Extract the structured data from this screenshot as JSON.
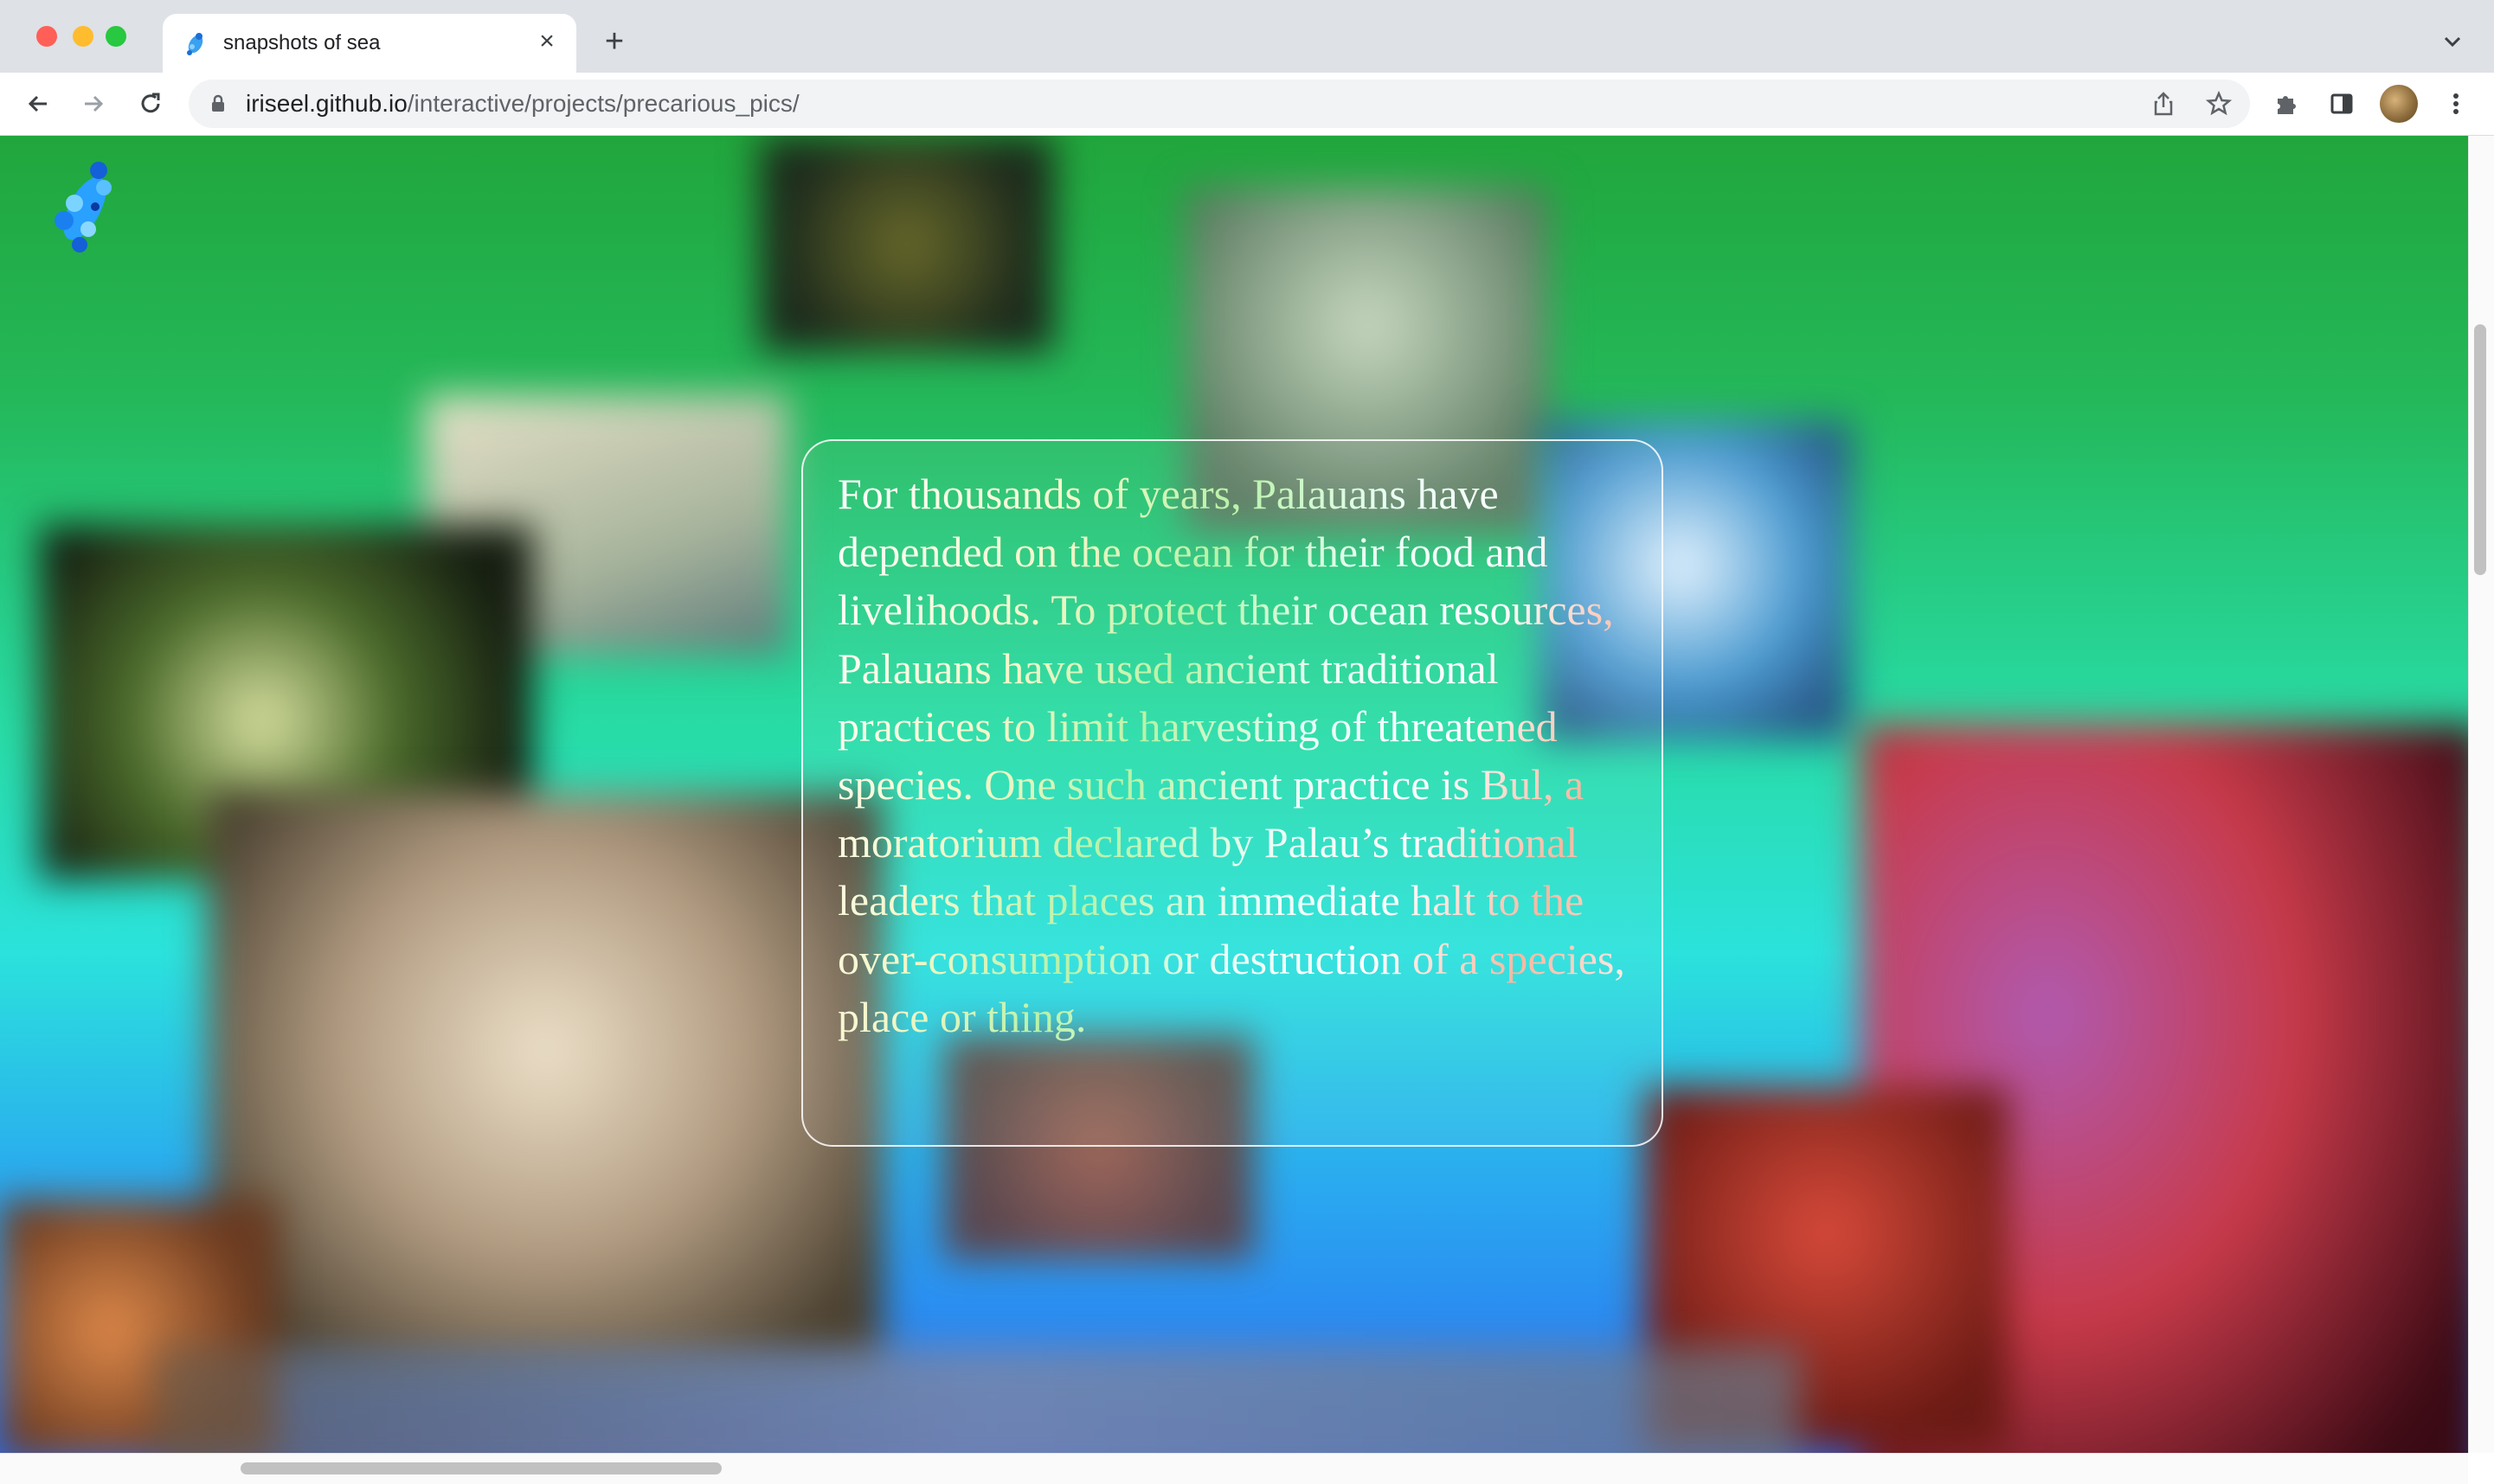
{
  "browser": {
    "tab": {
      "title": "snapshots of sea",
      "favicon": "fish-icon"
    },
    "address": {
      "host": "iriseel.github.io",
      "path": "/interactive/projects/precarious_pics/"
    },
    "colors": {
      "chrome": "#dee1e6",
      "close": "#ff5f57",
      "minimize": "#febc2e",
      "maximize": "#28c840"
    }
  },
  "page": {
    "logo": "koi-fish-icon",
    "colors": {
      "gradient_top": "#21a63c",
      "gradient_mid": "#2be2dc",
      "gradient_bottom": "#2a6ef2"
    },
    "text": "For thousands of years, Palauans have depended on the ocean for their food and livelihoods. To protect their ocean resources, Palauans have used ancient traditional practices to limit harvesting of threatened species. One such ancient practice is Bul, a moratorium declared by Palau’s traditional leaders that places an immediate halt to the over-consumption or destruction of a species, place or thing."
  }
}
